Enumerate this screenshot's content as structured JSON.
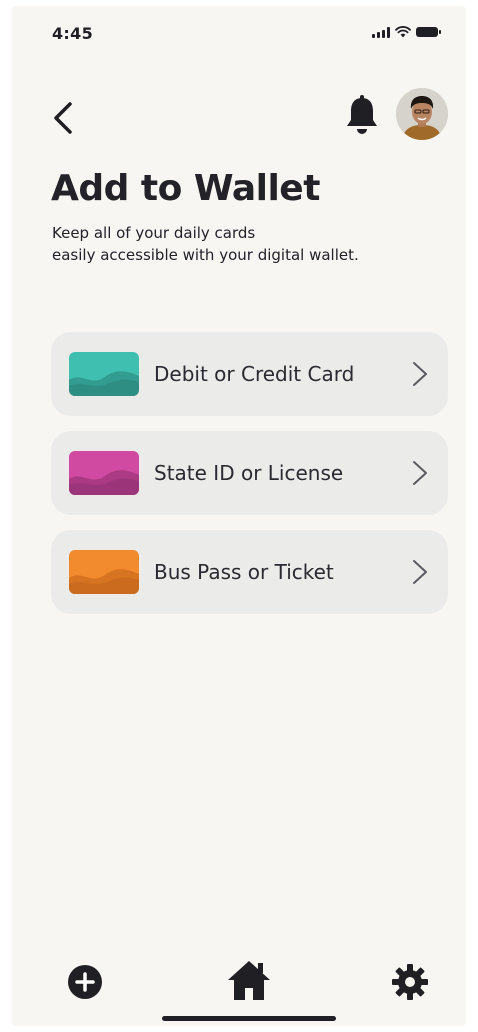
{
  "status_bar": {
    "time": "4:45"
  },
  "header": {
    "back_icon": "chevron-left-icon",
    "notification_icon": "bell-icon",
    "avatar_icon": "user-avatar"
  },
  "main": {
    "title": "Add to Wallet",
    "subtitle_line1": "Keep all of your daily cards",
    "subtitle_line2": "easily accessible with your digital wallet.",
    "options": [
      {
        "label": "Debit or Credit Card",
        "color": "#3fbfb0",
        "wave_color": "#2a7f78"
      },
      {
        "label": "State ID or License",
        "color": "#cf4aa0",
        "wave_color": "#8e2e6e"
      },
      {
        "label": "Bus Pass or Ticket",
        "color": "#f28a2e",
        "wave_color": "#c0621a"
      }
    ]
  },
  "bottom_nav": {
    "add_icon": "plus-circle-icon",
    "home_icon": "home-icon",
    "settings_icon": "gear-icon"
  }
}
